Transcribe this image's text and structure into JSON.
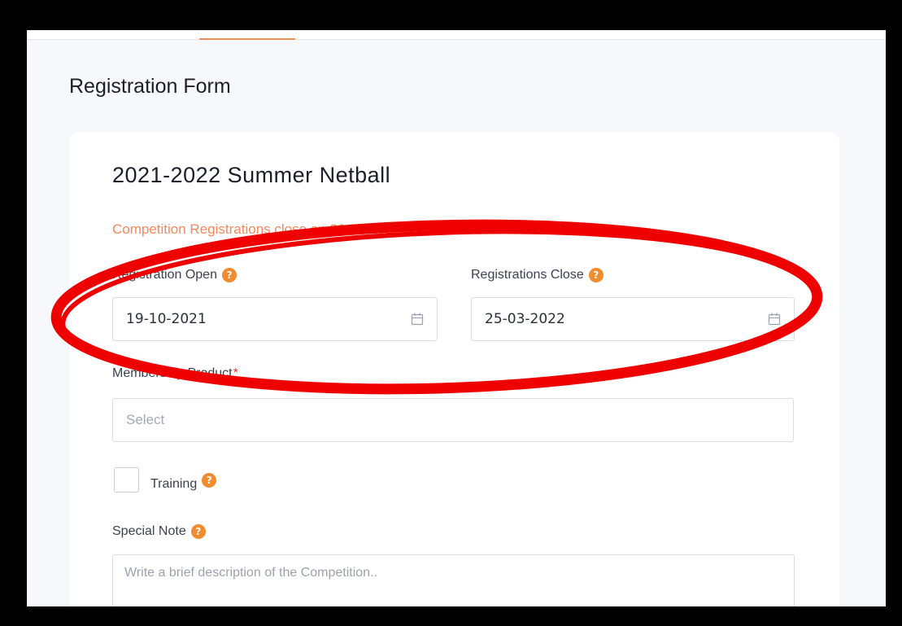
{
  "page": {
    "title": "Registration Form"
  },
  "competition": {
    "name": "2021-2022 Summer Netball",
    "close_notice": "Competition Registrations close on 26-03-2022"
  },
  "fields": {
    "registration_open": {
      "label": "Registration Open",
      "value": "19-10-2021"
    },
    "registrations_close": {
      "label": "Registrations Close",
      "value": "25-03-2022"
    },
    "membership_product": {
      "label": "Membership Product",
      "required_mark": "*",
      "placeholder": "Select"
    },
    "training": {
      "label": "Training",
      "checked": false
    },
    "special_note": {
      "label": "Special Note",
      "placeholder": "Write a brief description of the Competition.."
    }
  },
  "icons": {
    "help": "?",
    "calendar": "calendar-icon"
  },
  "colors": {
    "accent": "#f28c55",
    "help_icon": "#f28c2e",
    "notice_text": "#f5875b",
    "annotation_ring": "#ee0000"
  }
}
